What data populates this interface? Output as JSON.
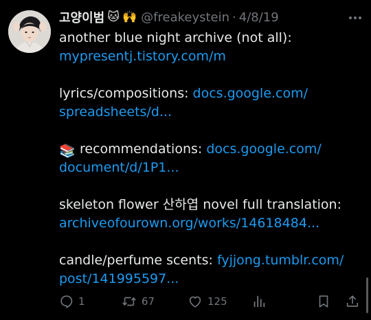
{
  "author": {
    "display_name": "고양이범",
    "emoji": [
      "🐱",
      "🙌"
    ],
    "handle": "@freakeystein",
    "separator": "·",
    "date": "4/8/19"
  },
  "tweet": {
    "lines": [
      {
        "text": "another blue night archive (not all):",
        "link": "mypresentj.tistory.com/m"
      },
      {
        "text": "lyrics/compositions: ",
        "link_inline": "docs.google.com/",
        "link": "spreadsheets/d..."
      },
      {
        "emoji": "📚",
        "text": "recommendations: ",
        "link_inline": "docs.google.com/",
        "link": "document/d/1P1..."
      },
      {
        "text": "skeleton flower 산하엽 novel full translation:",
        "link": "archiveofourown.org/works/14618484..."
      },
      {
        "text": "candle/perfume scents: ",
        "link_inline": "fyjjong.tumblr.com/",
        "link": "post/141995597..."
      }
    ]
  },
  "actions": {
    "replies": "1",
    "retweets": "67",
    "likes": "125"
  },
  "colors": {
    "background": "#000000",
    "text": "#e7e9ea",
    "muted": "#71767b",
    "link": "#1d9bf0"
  }
}
